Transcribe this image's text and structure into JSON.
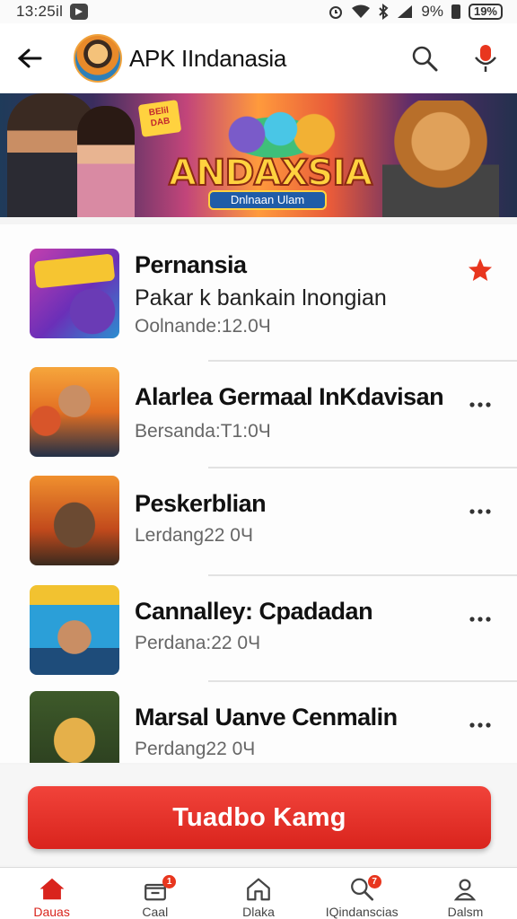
{
  "status_bar": {
    "time": "13:25il",
    "battery": "19%",
    "signal_percent": "9%"
  },
  "app_bar": {
    "title": "APK IIndanasia"
  },
  "banner": {
    "logo_text": "ANDAXSIA",
    "subtitle": "Dnlnaan Ulam",
    "tag": "BElil DAB"
  },
  "apps": [
    {
      "title": "Pernansia",
      "description": "Pakar k bankain lnongian",
      "meta": "Oolnande:12.0Ч",
      "action": "star"
    },
    {
      "title": "Alarlea Germaal InKdavisan",
      "description": "",
      "meta": "Bersanda:Т1:0Ч",
      "action": "more"
    },
    {
      "title": "Peskerblian",
      "description": "",
      "meta": "Lerdang22 0Ч",
      "action": "more"
    },
    {
      "title": "Cannalley: Cpadadan",
      "description": "",
      "meta": "Perdana:22 0Ч",
      "action": "more"
    },
    {
      "title": "Marsal Uanve Cenmalin",
      "description": "",
      "meta": "Perdang22 0Ч",
      "action": "more"
    }
  ],
  "cta": {
    "label": "Tuadbo Kamg"
  },
  "bottom_nav": [
    {
      "label": "Dauas",
      "icon": "home-icon",
      "badge": ""
    },
    {
      "label": "Caal",
      "icon": "store-icon",
      "badge": "1"
    },
    {
      "label": "Dlaka",
      "icon": "house-outline-icon",
      "badge": ""
    },
    {
      "label": "IQindanscias",
      "icon": "search-icon",
      "badge": "7"
    },
    {
      "label": "Dalsm",
      "icon": "profile-icon",
      "badge": ""
    }
  ],
  "colors": {
    "accent": "#d9241d",
    "star": "#e8361e"
  }
}
